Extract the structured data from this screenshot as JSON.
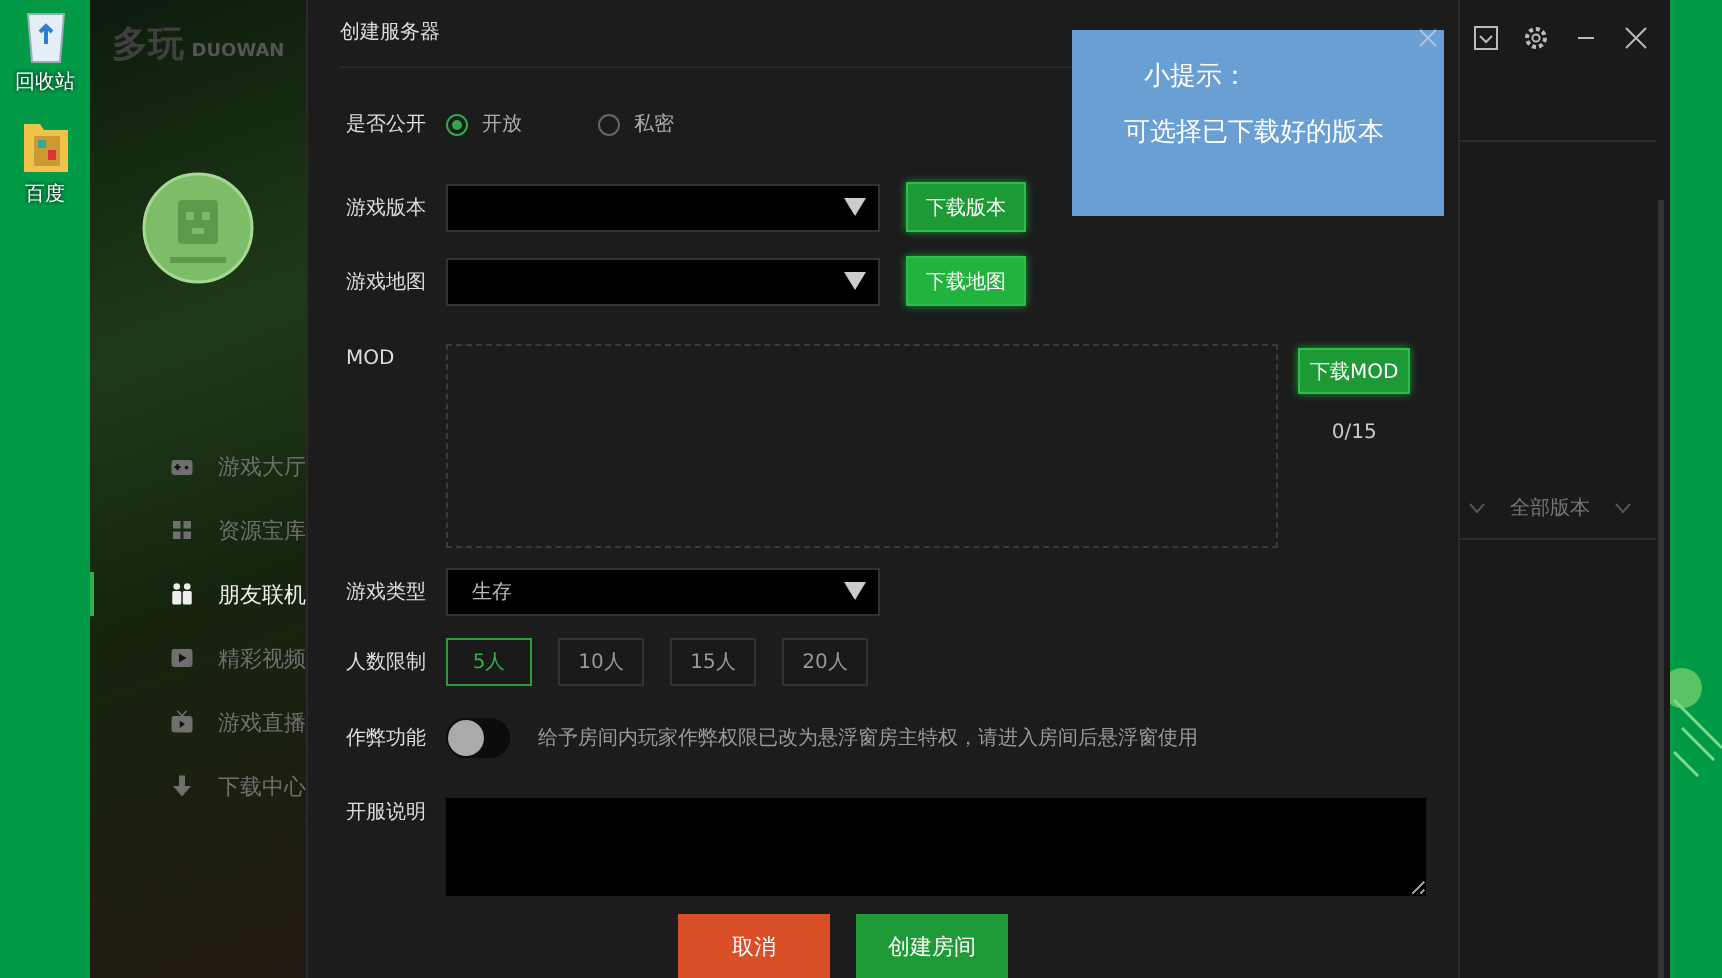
{
  "desktop": {
    "icons": [
      {
        "label": "回收站",
        "kind": "bin"
      },
      {
        "label": "百度",
        "kind": "folder"
      }
    ]
  },
  "logo": {
    "text": "多玩",
    "subtext": "DUOWAN"
  },
  "sidebar": {
    "items": [
      {
        "label": "游戏大厅",
        "kind": "gamepad",
        "selected": false
      },
      {
        "label": "资源宝库",
        "kind": "grid",
        "selected": false
      },
      {
        "label": "朋友联机",
        "kind": "people",
        "selected": true
      },
      {
        "label": "精彩视频",
        "kind": "play",
        "selected": false
      },
      {
        "label": "游戏直播",
        "kind": "tv",
        "selected": false
      },
      {
        "label": "下载中心",
        "kind": "download",
        "selected": false
      }
    ]
  },
  "dialog": {
    "title": "创建服务器",
    "visibility": {
      "label": "是否公开",
      "options": [
        {
          "label": "开放",
          "selected": true
        },
        {
          "label": "私密",
          "selected": false
        }
      ]
    },
    "version": {
      "label": "游戏版本",
      "button": "下载版本"
    },
    "map": {
      "label": "游戏地图",
      "button": "下载地图"
    },
    "mod": {
      "label": "MOD",
      "button": "下载MOD",
      "count": "0/15"
    },
    "game_type": {
      "label": "游戏类型",
      "value": "生存"
    },
    "player_limit": {
      "label": "人数限制",
      "options": [
        {
          "label": "5人",
          "selected": true
        },
        {
          "label": "10人",
          "selected": false
        },
        {
          "label": "15人",
          "selected": false
        },
        {
          "label": "20人",
          "selected": false
        }
      ]
    },
    "cheats": {
      "label": "作弊功能",
      "on": false,
      "note": "给予房间内玩家作弊权限已改为悬浮窗房主特权，请进入房间后悬浮窗使用"
    },
    "description": {
      "label": "开服说明"
    },
    "buttons": [
      {
        "label": "取消",
        "kind": "cancel"
      },
      {
        "label": "创建房间",
        "kind": "primary"
      }
    ]
  },
  "tooltip": {
    "title": "小提示：",
    "text": "可选择已下载好的版本"
  },
  "right_panel": {
    "filter": "全部版本"
  }
}
